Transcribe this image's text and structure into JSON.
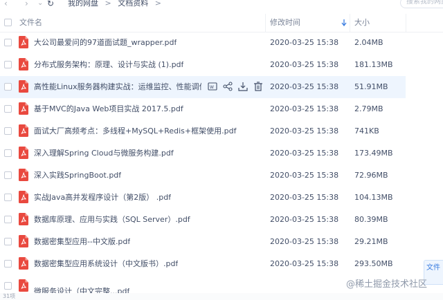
{
  "toolbar": {
    "breadcrumb": [
      "我的网盘",
      "文档资料"
    ],
    "search_placeholder": "搜索我的网盘"
  },
  "table": {
    "col_name": "文件名",
    "col_date": "修改时间",
    "col_size": "大小",
    "rows": [
      {
        "name": "大公司最爱问的97道面试题_wrapper.pdf",
        "date": "2020-03-25 15:38",
        "size": "2.04MB"
      },
      {
        "name": "分布式服务架构：原理、设计与实战 (1).pdf",
        "date": "2020-03-25 15:38",
        "size": "181.13MB"
      },
      {
        "name": "高性能Linux服务器构建实战：运维监控、性能调优与...",
        "date": "2020-03-25 15:38",
        "size": "51.91MB"
      },
      {
        "name": "基于MVC的Java Web项目实战 2017.5.pdf",
        "date": "2020-03-25 15:38",
        "size": "2.79MB"
      },
      {
        "name": "面试大厂高频考点：多线程+MySQL+Redis+框架使用.pdf",
        "date": "2020-03-25 15:38",
        "size": "741KB"
      },
      {
        "name": "深入理解Spring Cloud与微服务构建.pdf",
        "date": "2020-03-25 15:38",
        "size": "173.49MB"
      },
      {
        "name": "深入实践SpringBoot.pdf",
        "date": "2020-03-25 15:38",
        "size": "72.96MB"
      },
      {
        "name": "实战Java高并发程序设计（第2版） .pdf",
        "date": "2020-03-25 15:38",
        "size": "104.13MB"
      },
      {
        "name": "数据库原理、应用与实践（SQL Server）.pdf",
        "date": "2020-03-25 15:38",
        "size": "80.39MB"
      },
      {
        "name": "数据密集型应用--中文版.pdf",
        "date": "2020-03-25 15:38",
        "size": "29.21MB"
      },
      {
        "name": "数据密集型应用系统设计（中文版书）.pdf",
        "date": "2020-03-25 15:38",
        "size": "293.50MB"
      },
      {
        "name": "微服务设计（中文完整...pdf",
        "date": "",
        "size": ""
      }
    ]
  },
  "side_tab_label": "文件",
  "watermark": "@稀土掘金技术社区",
  "footer_text": "31项",
  "colors": {
    "accent": "#3a7de0",
    "pdf_red": "#e9493f",
    "active_row": "#eef5fe"
  }
}
